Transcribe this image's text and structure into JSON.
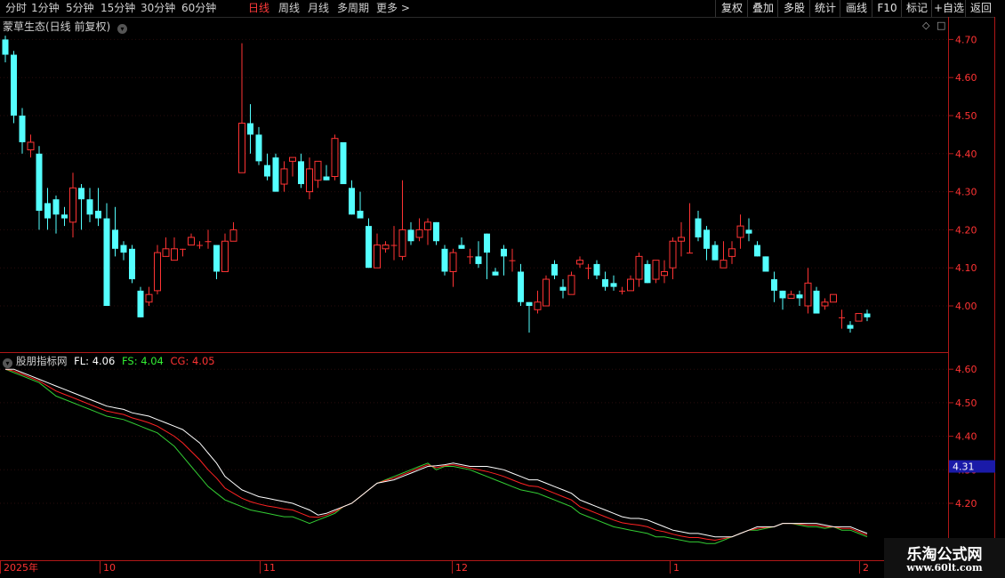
{
  "period_tabs": [
    "分时",
    "1分钟",
    "5分钟",
    "15分钟",
    "30分钟",
    "60分钟",
    "日线",
    "周线",
    "月线",
    "多周期",
    "更多 >"
  ],
  "active_tab": "日线",
  "toolbar_buttons": [
    "复权",
    "叠加",
    "多股",
    "统计",
    "画线",
    "F10",
    "标记",
    "+自选",
    "返回"
  ],
  "main_chart": {
    "title": "蒙草生态(日线 前复权)",
    "y_ticks": [
      "4.70",
      "4.60",
      "4.50",
      "4.40",
      "4.30",
      "4.20",
      "4.10",
      "4.00"
    ]
  },
  "indicator": {
    "name": "股朋指标网",
    "fl_label": "FL: 4.06",
    "fs_label": "FS: 4.04",
    "cg_label": "CG: 4.05",
    "y_ticks": [
      "4.60",
      "4.50",
      "4.40",
      "4.30",
      "4.20"
    ],
    "current_value": "4.31"
  },
  "date_axis": [
    "2025年",
    "10",
    "11",
    "12",
    "1",
    "2"
  ],
  "watermark": {
    "line1": "乐淘公式网",
    "line2": "www.60lt.com"
  },
  "colors": {
    "up": "#ff3333",
    "down": "#54ffff",
    "fs": "#33cc33",
    "fl": "#ffffff",
    "cg": "#ff2222",
    "tab_active": "#ff3a3a"
  },
  "chart_data": {
    "type": "candlestick",
    "candles": [
      [
        4.7,
        4.66,
        4.71,
        4.64
      ],
      [
        4.66,
        4.5,
        4.67,
        4.48
      ],
      [
        4.5,
        4.43,
        4.52,
        4.4
      ],
      [
        4.41,
        4.43,
        4.45,
        4.39
      ],
      [
        4.4,
        4.25,
        4.42,
        4.2
      ],
      [
        4.27,
        4.23,
        4.31,
        4.2
      ],
      [
        4.28,
        4.24,
        4.29,
        4.19
      ],
      [
        4.24,
        4.23,
        4.26,
        4.21
      ],
      [
        4.22,
        4.31,
        4.35,
        4.18
      ],
      [
        4.31,
        4.28,
        4.32,
        4.2
      ],
      [
        4.28,
        4.24,
        4.31,
        4.22
      ],
      [
        4.25,
        4.23,
        4.31,
        4.21
      ],
      [
        4.23,
        4.0,
        4.27,
        4.0
      ],
      [
        4.2,
        4.15,
        4.26,
        4.13
      ],
      [
        4.16,
        4.14,
        4.17,
        4.12
      ],
      [
        4.15,
        4.07,
        4.16,
        4.06
      ],
      [
        4.04,
        3.97,
        4.05,
        3.97
      ],
      [
        4.01,
        4.03,
        4.05,
        4.0
      ],
      [
        4.04,
        4.14,
        4.16,
        4.03
      ],
      [
        4.13,
        4.15,
        4.18,
        4.13
      ],
      [
        4.12,
        4.15,
        4.18,
        4.12
      ],
      [
        4.15,
        4.15,
        4.15,
        4.13
      ],
      [
        4.16,
        4.18,
        4.19,
        4.16
      ],
      [
        4.16,
        4.16,
        4.17,
        4.15
      ],
      [
        4.17,
        4.17,
        4.2,
        4.15
      ],
      [
        4.16,
        4.09,
        4.16,
        4.07
      ],
      [
        4.09,
        4.17,
        4.19,
        4.09
      ],
      [
        4.17,
        4.2,
        4.22,
        4.17
      ],
      [
        4.35,
        4.48,
        4.69,
        4.41
      ],
      [
        4.48,
        4.45,
        4.53,
        4.4
      ],
      [
        4.45,
        4.38,
        4.47,
        4.37
      ],
      [
        4.37,
        4.34,
        4.4,
        4.33
      ],
      [
        4.39,
        4.3,
        4.4,
        4.3
      ],
      [
        4.32,
        4.36,
        4.38,
        4.3
      ],
      [
        4.38,
        4.39,
        4.39,
        4.34
      ],
      [
        4.38,
        4.32,
        4.4,
        4.31
      ],
      [
        4.3,
        4.36,
        4.39,
        4.28
      ],
      [
        4.33,
        4.38,
        4.38,
        4.31
      ],
      [
        4.34,
        4.33,
        4.37,
        4.33
      ],
      [
        4.34,
        4.44,
        4.45,
        4.33
      ],
      [
        4.43,
        4.32,
        4.43,
        4.32
      ],
      [
        4.31,
        4.24,
        4.33,
        4.24
      ],
      [
        4.25,
        4.23,
        4.3,
        4.23
      ],
      [
        4.21,
        4.1,
        4.23,
        4.1
      ],
      [
        4.1,
        4.16,
        4.19,
        4.1
      ],
      [
        4.15,
        4.16,
        4.17,
        4.14
      ],
      [
        4.16,
        4.16,
        4.21,
        4.12
      ],
      [
        4.13,
        4.2,
        4.33,
        4.12
      ],
      [
        4.2,
        4.17,
        4.22,
        4.16
      ],
      [
        4.18,
        4.2,
        4.23,
        4.17
      ],
      [
        4.2,
        4.22,
        4.23,
        4.16
      ],
      [
        4.22,
        4.17,
        4.22,
        4.16
      ],
      [
        4.15,
        4.09,
        4.16,
        4.08
      ],
      [
        4.09,
        4.14,
        4.15,
        4.05
      ],
      [
        4.16,
        4.15,
        4.18,
        4.15
      ],
      [
        4.13,
        4.13,
        4.15,
        4.11
      ],
      [
        4.13,
        4.11,
        4.17,
        4.1
      ],
      [
        4.19,
        4.14,
        4.19,
        4.07
      ],
      [
        4.09,
        4.08,
        4.1,
        4.08
      ],
      [
        4.15,
        4.13,
        4.16,
        4.08
      ],
      [
        4.12,
        4.12,
        4.15,
        4.09
      ],
      [
        4.09,
        4.01,
        4.11,
        4.0
      ],
      [
        4.01,
        4.0,
        4.01,
        3.93
      ],
      [
        3.99,
        4.01,
        4.04,
        3.98
      ],
      [
        4.0,
        4.07,
        4.08,
        4.0
      ],
      [
        4.11,
        4.08,
        4.12,
        4.07
      ],
      [
        4.05,
        4.04,
        4.07,
        4.02
      ],
      [
        4.03,
        4.08,
        4.09,
        4.03
      ],
      [
        4.11,
        4.12,
        4.13,
        4.1
      ],
      [
        4.1,
        4.1,
        4.11,
        4.07
      ],
      [
        4.11,
        4.08,
        4.12,
        4.07
      ],
      [
        4.07,
        4.05,
        4.09,
        4.04
      ],
      [
        4.06,
        4.05,
        4.08,
        4.04
      ],
      [
        4.04,
        4.04,
        4.05,
        4.03
      ],
      [
        4.04,
        4.07,
        4.08,
        4.04
      ],
      [
        4.07,
        4.13,
        4.14,
        4.05
      ],
      [
        4.11,
        4.06,
        4.12,
        4.06
      ],
      [
        4.07,
        4.12,
        4.12,
        4.06
      ],
      [
        4.08,
        4.09,
        4.12,
        4.06
      ],
      [
        4.1,
        4.17,
        4.18,
        4.07
      ],
      [
        4.17,
        4.18,
        4.22,
        4.13
      ],
      [
        4.14,
        4.14,
        4.27,
        4.14
      ],
      [
        4.23,
        4.18,
        4.25,
        4.17
      ],
      [
        4.2,
        4.15,
        4.21,
        4.12
      ],
      [
        4.16,
        4.12,
        4.17,
        4.12
      ],
      [
        4.1,
        4.12,
        4.17,
        4.1
      ],
      [
        4.13,
        4.15,
        4.17,
        4.11
      ],
      [
        4.18,
        4.21,
        4.24,
        4.15
      ],
      [
        4.2,
        4.19,
        4.23,
        4.17
      ],
      [
        4.16,
        4.13,
        4.17,
        4.13
      ],
      [
        4.13,
        4.09,
        4.13,
        4.09
      ],
      [
        4.07,
        4.04,
        4.09,
        4.01
      ],
      [
        4.04,
        4.02,
        4.04,
        3.99
      ],
      [
        4.02,
        4.03,
        4.04,
        4.02
      ],
      [
        4.03,
        4.02,
        4.04,
        4.0
      ],
      [
        4.0,
        4.06,
        4.1,
        3.98
      ],
      [
        4.04,
        3.98,
        4.05,
        3.98
      ],
      [
        4.0,
        4.01,
        4.02,
        3.99
      ],
      [
        4.01,
        4.03,
        4.03,
        4.01
      ],
      [
        3.97,
        3.97,
        3.99,
        3.94
      ],
      [
        3.95,
        3.94,
        3.96,
        3.93
      ],
      [
        3.96,
        3.98,
        3.98,
        3.96
      ],
      [
        3.98,
        3.97,
        3.99,
        3.96
      ]
    ],
    "fl": [
      4.6,
      4.6,
      4.59,
      4.58,
      4.57,
      4.56,
      4.55,
      4.54,
      4.53,
      4.52,
      4.51,
      4.5,
      4.49,
      4.485,
      4.48,
      4.47,
      4.465,
      4.46,
      4.45,
      4.44,
      4.43,
      4.42,
      4.4,
      4.38,
      4.35,
      4.32,
      4.28,
      4.26,
      4.24,
      4.23,
      4.22,
      4.215,
      4.21,
      4.205,
      4.2,
      4.19,
      4.18,
      4.165,
      4.17,
      4.18,
      4.19,
      4.2,
      4.22,
      4.24,
      4.26,
      4.265,
      4.27,
      4.28,
      4.29,
      4.3,
      4.31,
      4.312,
      4.315,
      4.32,
      4.315,
      4.31,
      4.31,
      4.31,
      4.305,
      4.3,
      4.29,
      4.28,
      4.27,
      4.27,
      4.26,
      4.25,
      4.24,
      4.23,
      4.21,
      4.2,
      4.19,
      4.18,
      4.17,
      4.16,
      4.155,
      4.155,
      4.15,
      4.14,
      4.13,
      4.12,
      4.115,
      4.11,
      4.11,
      4.105,
      4.1,
      4.1,
      4.1,
      4.11,
      4.12,
      4.13,
      4.13,
      4.13,
      4.14,
      4.14,
      4.14,
      4.14,
      4.14,
      4.135,
      4.13,
      4.13,
      4.13,
      4.12,
      4.11
    ],
    "fs": [
      4.6,
      4.59,
      4.58,
      4.57,
      4.56,
      4.54,
      4.52,
      4.51,
      4.5,
      4.49,
      4.48,
      4.47,
      4.46,
      4.455,
      4.45,
      4.44,
      4.43,
      4.42,
      4.41,
      4.39,
      4.37,
      4.34,
      4.31,
      4.28,
      4.25,
      4.23,
      4.21,
      4.2,
      4.19,
      4.18,
      4.175,
      4.17,
      4.165,
      4.16,
      4.16,
      4.15,
      4.14,
      4.15,
      4.16,
      4.17,
      4.19,
      4.2,
      4.22,
      4.24,
      4.26,
      4.27,
      4.28,
      4.29,
      4.3,
      4.31,
      4.32,
      4.3,
      4.31,
      4.31,
      4.305,
      4.3,
      4.29,
      4.28,
      4.27,
      4.26,
      4.25,
      4.24,
      4.235,
      4.23,
      4.22,
      4.21,
      4.2,
      4.19,
      4.17,
      4.16,
      4.15,
      4.14,
      4.13,
      4.125,
      4.12,
      4.115,
      4.11,
      4.1,
      4.1,
      4.095,
      4.09,
      4.085,
      4.085,
      4.08,
      4.08,
      4.09,
      4.1,
      4.11,
      4.12,
      4.12,
      4.125,
      4.13,
      4.14,
      4.14,
      4.135,
      4.13,
      4.13,
      4.125,
      4.13,
      4.12,
      4.12,
      4.11,
      4.1
    ],
    "cg": [
      4.6,
      4.595,
      4.585,
      4.575,
      4.565,
      4.55,
      4.535,
      4.525,
      4.515,
      4.505,
      4.495,
      4.485,
      4.475,
      4.47,
      4.465,
      4.455,
      4.448,
      4.44,
      4.43,
      4.415,
      4.4,
      4.38,
      4.355,
      4.33,
      4.3,
      4.275,
      4.245,
      4.23,
      4.215,
      4.205,
      4.198,
      4.192,
      4.188,
      4.183,
      4.18,
      4.17,
      4.16,
      4.158,
      4.165,
      4.175,
      4.19,
      4.2,
      4.22,
      4.24,
      4.26,
      4.268,
      4.275,
      4.285,
      4.295,
      4.305,
      4.315,
      4.306,
      4.312,
      4.315,
      4.31,
      4.305,
      4.3,
      4.295,
      4.288,
      4.28,
      4.27,
      4.26,
      4.252,
      4.25,
      4.24,
      4.23,
      4.22,
      4.21,
      4.19,
      4.18,
      4.17,
      4.16,
      4.15,
      4.142,
      4.138,
      4.135,
      4.13,
      4.12,
      4.115,
      4.108,
      4.102,
      4.098,
      4.098,
      4.093,
      4.09,
      4.095,
      4.1,
      4.11,
      4.12,
      4.125,
      4.128,
      4.13,
      4.14,
      4.14,
      4.138,
      4.135,
      4.135,
      4.13,
      4.13,
      4.125,
      4.125,
      4.115,
      4.105
    ]
  }
}
